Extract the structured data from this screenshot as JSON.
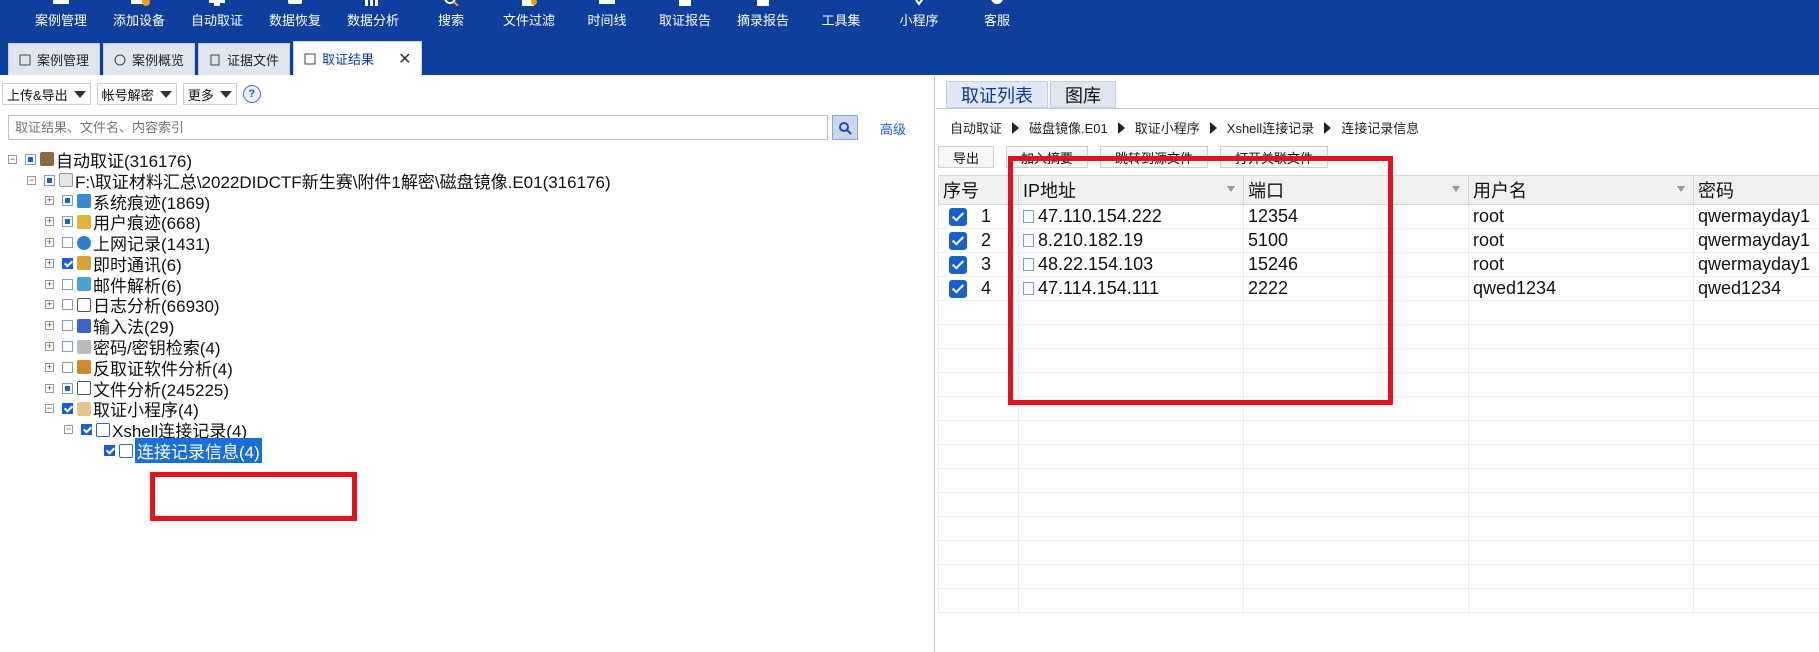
{
  "toolbar": {
    "items": [
      {
        "label": "案例管理",
        "icon": "case-icon"
      },
      {
        "label": "添加设备",
        "icon": "add-device-icon"
      },
      {
        "label": "自动取证",
        "icon": "auto-forensics-icon"
      },
      {
        "label": "数据恢复",
        "icon": "data-recovery-icon"
      },
      {
        "label": "数据分析",
        "icon": "data-analysis-icon"
      },
      {
        "label": "搜索",
        "icon": "search-icon"
      },
      {
        "label": "文件过滤",
        "icon": "file-filter-icon"
      },
      {
        "label": "时间线",
        "icon": "timeline-icon"
      },
      {
        "label": "取证报告",
        "icon": "report-icon"
      },
      {
        "label": "摘录报告",
        "icon": "excerpt-report-icon"
      },
      {
        "label": "工具集",
        "icon": "toolkit-icon"
      },
      {
        "label": "小程序",
        "icon": "applet-icon"
      },
      {
        "label": "客服",
        "icon": "support-icon"
      }
    ]
  },
  "tabs": [
    {
      "label": "案例管理",
      "active": false
    },
    {
      "label": "案例概览",
      "active": false
    },
    {
      "label": "证据文件",
      "active": false
    },
    {
      "label": "取证结果",
      "active": true
    }
  ],
  "left": {
    "upload_export": "上传&导出",
    "account_decrypt": "帐号解密",
    "more": "更多",
    "help": "?",
    "search_placeholder": "取证结果、文件名、内容索引",
    "advanced": "高级",
    "tree": [
      {
        "label": "自动取证(316176)"
      },
      {
        "label": "F:\\取证材料汇总\\2022DIDCTF新生赛\\附件1解密\\磁盘镜像.E01(316176)"
      },
      {
        "label": "系统痕迹(1869)"
      },
      {
        "label": "用户痕迹(668)"
      },
      {
        "label": "上网记录(1431)"
      },
      {
        "label": "即时通讯(6)"
      },
      {
        "label": "邮件解析(6)"
      },
      {
        "label": "日志分析(66930)"
      },
      {
        "label": "输入法(29)"
      },
      {
        "label": "密码/密钥检索(4)"
      },
      {
        "label": "反取证软件分析(4)"
      },
      {
        "label": "文件分析(245225)"
      },
      {
        "label": "取证小程序(4)"
      },
      {
        "label": "Xshell连接记录(4)"
      },
      {
        "label": "连接记录信息(4)"
      }
    ]
  },
  "right": {
    "tabs": [
      "取证列表",
      "图库"
    ],
    "breadcrumb": [
      "自动取证",
      "磁盘镜像.E01",
      "取证小程序",
      "Xshell连接记录",
      "连接记录信息"
    ],
    "actions": [
      "导出",
      "加入摘要",
      "跳转到源文件",
      "打开关联文件"
    ],
    "columns": [
      "序号",
      "IP地址",
      "端口",
      "用户名",
      "密码"
    ],
    "rows": [
      {
        "seq": "1",
        "ip": "47.110.154.222",
        "port": "12354",
        "user": "root",
        "password": "qwermayday1"
      },
      {
        "seq": "2",
        "ip": "8.210.182.19",
        "port": "5100",
        "user": "root",
        "password": "qwermayday1"
      },
      {
        "seq": "3",
        "ip": "48.22.154.103",
        "port": "15246",
        "user": "root",
        "password": "qwermayday1"
      },
      {
        "seq": "4",
        "ip": "47.114.154.111",
        "port": "2222",
        "user": "qwed1234",
        "password": "qwed1234"
      }
    ]
  },
  "colors": {
    "toolbar_bg": "#0f3f9c",
    "accent": "#1a5fd0",
    "highlight": "#e0141e"
  }
}
